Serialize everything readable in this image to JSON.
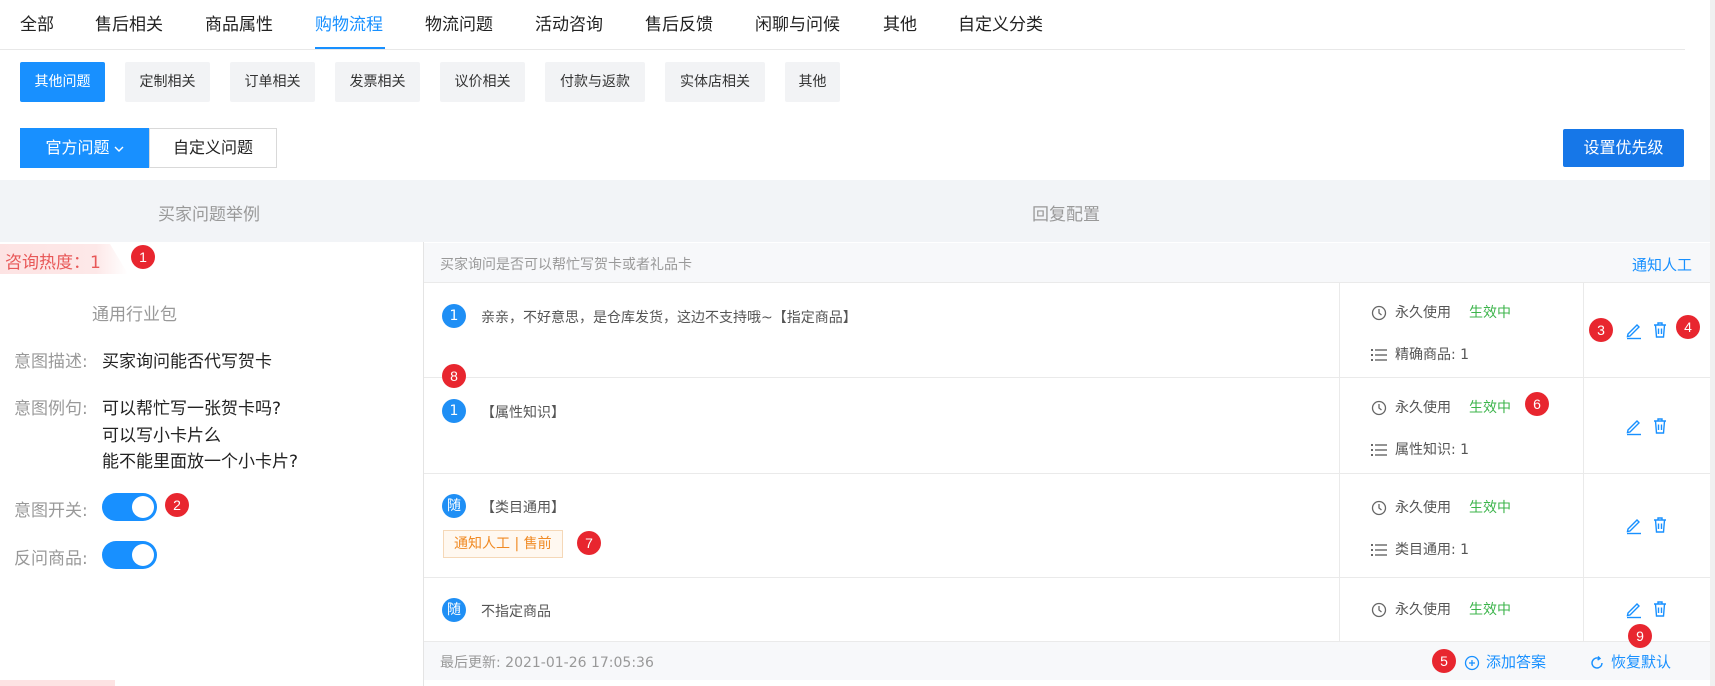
{
  "top_tabs": [
    "全部",
    "售后相关",
    "商品属性",
    "购物流程",
    "物流问题",
    "活动咨询",
    "售后反馈",
    "闲聊与问候",
    "其他",
    "自定义分类"
  ],
  "active_top_tab": "购物流程",
  "sub_chips": [
    "其他问题",
    "定制相关",
    "订单相关",
    "发票相关",
    "议价相关",
    "付款与返款",
    "实体店相关",
    "其他"
  ],
  "active_chip": "其他问题",
  "segment": {
    "official": "官方问题",
    "custom": "自定义问题"
  },
  "priority_button": "设置优先级",
  "headers": {
    "left": "买家问题举例",
    "right": "回复配置"
  },
  "left": {
    "heat": "咨询热度：1",
    "package": "通用行业包",
    "intent_desc_label": "意图描述:",
    "intent_desc": "买家询问能否代写贺卡",
    "examples_label": "意图例句:",
    "examples": [
      "可以帮忙写一张贺卡吗?",
      "可以写小卡片么",
      "能不能里面放一个小卡片?"
    ],
    "switch_label": "意图开关:",
    "reverse_label": "反问商品:"
  },
  "right": {
    "question": "买家询问是否可以帮忙写贺卡或者礼品卡",
    "notify": "通知人工",
    "rows": [
      {
        "badge": "1",
        "answer": "亲亲，不好意思，是仓库发货，这边不支持哦~【指定商品】",
        "usage": "永久使用",
        "status": "生效中",
        "scope": "精确商品: 1"
      },
      {
        "badge": "1",
        "answer": "【属性知识】",
        "usage": "永久使用",
        "status": "生效中",
        "scope": "属性知识: 1"
      },
      {
        "badge": "随",
        "answer": "【类目通用】",
        "tag": "通知人工 | 售前",
        "usage": "永久使用",
        "status": "生效中",
        "scope": "类目通用: 1"
      },
      {
        "badge": "随",
        "answer": "不指定商品",
        "usage": "永久使用",
        "status": "生效中"
      }
    ],
    "last_update": "最后更新: 2021-01-26 17:05:36",
    "add_answer": "添加答案",
    "restore_default": "恢复默认"
  },
  "markers": [
    "1",
    "2",
    "3",
    "4",
    "5",
    "6",
    "7",
    "8",
    "9"
  ],
  "colors": {
    "primary": "#1890ff",
    "status_green": "#3cb44b",
    "marker_red": "#e8262f",
    "tag_orange": "#f08a24"
  }
}
